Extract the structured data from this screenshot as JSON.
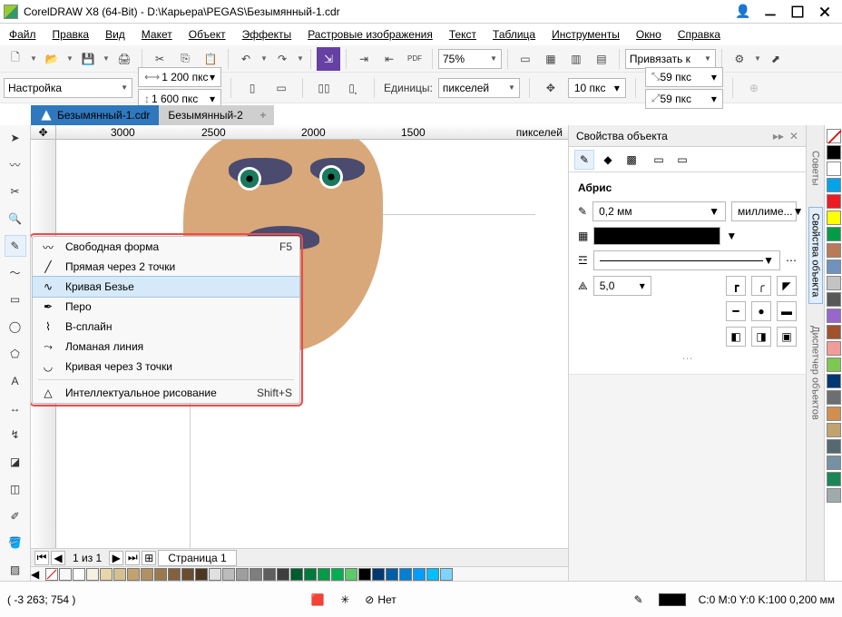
{
  "title": "CorelDRAW X8 (64-Bit) - D:\\Карьера\\PEGAS\\Безымянный-1.cdr",
  "menu": {
    "file": "Файл",
    "edit": "Правка",
    "view": "Вид",
    "layout": "Макет",
    "object": "Объект",
    "effects": "Эффекты",
    "bitmap": "Растровые изображения",
    "text": "Текст",
    "table": "Таблица",
    "tools": "Инструменты",
    "window": "Окно",
    "help": "Справка"
  },
  "toolbar": {
    "zoom": "75%",
    "snapTo": "Привязать к"
  },
  "propbar": {
    "preset": "Настройка",
    "width": "1 200 пкс",
    "height": "1 600 пкс",
    "unitsLabel": "Единицы:",
    "units": "пикселей",
    "nudge": "10 пкс",
    "dupx": "59 пкс",
    "dupy": "59 пкс"
  },
  "doctabs": {
    "active": "Безымянный-1.cdr",
    "other": "Безымянный-2"
  },
  "ruler": {
    "r1": "3000",
    "r2": "2500",
    "r3": "2000",
    "r4": "1500",
    "unit": "пикселей"
  },
  "flyout": {
    "freehand": {
      "label": "Свободная форма",
      "shortcut": "F5"
    },
    "line2pt": {
      "label": "Прямая через 2 точки"
    },
    "bezier": {
      "label": "Кривая Безье"
    },
    "pen": {
      "label": "Перо"
    },
    "bspline": {
      "label": "В-сплайн"
    },
    "polyline": {
      "label": "Ломаная линия"
    },
    "curve3pt": {
      "label": "Кривая через 3 точки"
    },
    "smart": {
      "label": "Интеллектуальное рисование",
      "shortcut": "Shift+S"
    }
  },
  "docker": {
    "title": "Свойства объекта",
    "section": "Абрис",
    "outlineWidth": "0,2 мм",
    "outlineUnits": "миллиме...",
    "miter": "5,0"
  },
  "pagenav": {
    "pages": "1 из 1",
    "pageTab": "Страница 1"
  },
  "status": {
    "coord": "( -3 263; 754 )",
    "fill": "Нет",
    "outline": "C:0 M:0 Y:0 K:100  0,200 мм"
  },
  "palette": [
    "#000000",
    "#ffffff",
    "#00a2e8",
    "#ed1c24",
    "#ffff00",
    "#009c48",
    "#b97a57",
    "#7092be",
    "#c3c3c3",
    "#585858",
    "#9966cc",
    "#a0522d",
    "#f29b9b",
    "#7ec850",
    "#003972",
    "#6d6e71",
    "#d18f4e",
    "#c2a36e",
    "#556970",
    "#7691a3",
    "#1b8756",
    "#9faaad"
  ],
  "hpalette": [
    "#00000000",
    "#ffffff",
    "#f5f0e1",
    "#e8d5a9",
    "#d6c08f",
    "#c2a36e",
    "#b29062",
    "#9a7a4c",
    "#83613e",
    "#6a4c30",
    "#4c3624",
    "#e0e0e0",
    "#bcbcbc",
    "#9e9e9e",
    "#7e7e7e",
    "#5e5e5e",
    "#3e3e3e",
    "#005c2e",
    "#007a3d",
    "#009c48",
    "#00b050",
    "#5cc96a",
    "#000000",
    "#003972",
    "#005da8",
    "#007fd4",
    "#009eff",
    "#00bfff",
    "#7cd5ff"
  ]
}
